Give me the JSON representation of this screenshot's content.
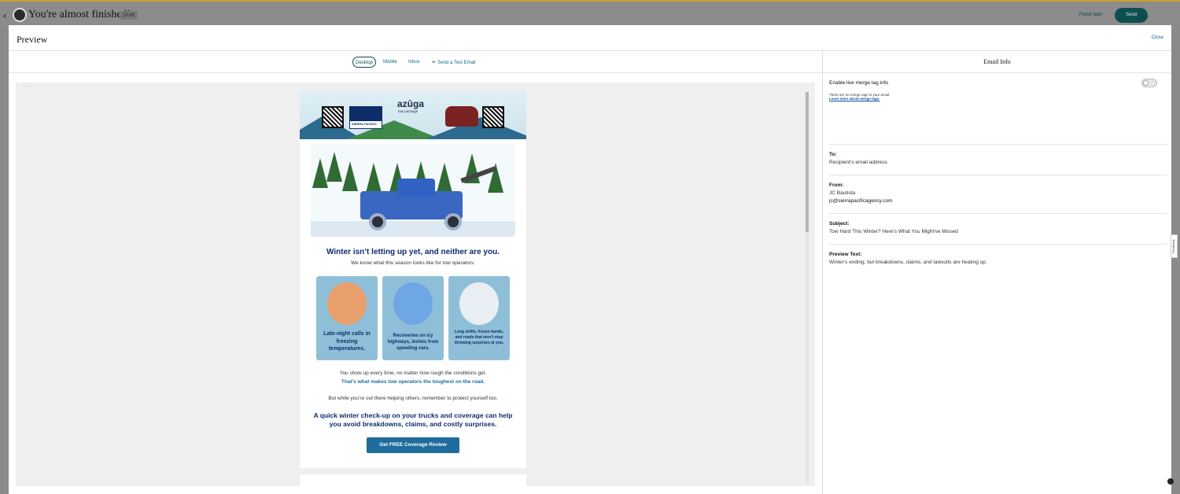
{
  "topbar": {
    "title": "You're almost finished!",
    "draft_badge": "Draft",
    "finish_later": "Finish later",
    "send": "Send"
  },
  "modal": {
    "title": "Preview",
    "close": "Close"
  },
  "tabs": [
    {
      "label": "Desktop",
      "active": true
    },
    {
      "label": "Mobile",
      "active": false
    },
    {
      "label": "Inbox",
      "active": false
    },
    {
      "label": "Send a Test Email",
      "active": false
    }
  ],
  "email": {
    "header": {
      "azuga": "azūga",
      "azuga_sub": "tow package",
      "sierra_pacific": "SIERRA PACIFIC",
      "sierra_fleet": "Sierra Fleet"
    },
    "headline": "Winter isn’t letting up yet, and neither are you.",
    "intro": "We know what this season looks like for tow operators:",
    "cards": [
      {
        "text": "Late-night calls in freezing temperatures."
      },
      {
        "text": "Recoveries on icy highways, inches from speeding cars."
      },
      {
        "text": "Long shifts, frozen hands, and roads that won’t stop throwing surprises at you."
      }
    ],
    "p2": "You show up every time, no matter how rough the conditions get.",
    "p3": "That’s what makes tow operators the toughest on the road.",
    "p4": "But while you’re out there helping others, remember to protect yourself too.",
    "headline2": "A quick winter check-up on your trucks and coverage can help you avoid breakdowns, claims, and costly surprises.",
    "cta": "Get FREE Coverage Review"
  },
  "email_info": {
    "title": "Email Info",
    "merge_toggle_label": "Enable live merge tag info",
    "merge_toggle_on": false,
    "merge_note": "There are no merge tags in your email.",
    "merge_link": "Learn more about merge tags.",
    "to_label": "To:",
    "to_value": "Recipient's email address",
    "from_label": "From:",
    "from_name": "JC Bautista",
    "from_email": "jc@sierrapacificagency.com",
    "subject_label": "Subject:",
    "subject_value": "Tow Hard This Winter? Here's What You Might've Missed",
    "preview_label": "Preview Text:",
    "preview_value": "Winter's ending, but breakdowns, claims, and lawsuits are heating up."
  },
  "feedback": "Feedback",
  "colors": {
    "brand_teal": "#0f4e4f",
    "link_blue": "#0f6b8c",
    "email_navy": "#0d2d6b",
    "cta_blue": "#1f6c9d",
    "card_blue": "#8fbfd8"
  },
  "icons": [
    "back-chevron-icon",
    "mailchimp-logo-icon",
    "paper-plane-icon",
    "help-icon"
  ]
}
